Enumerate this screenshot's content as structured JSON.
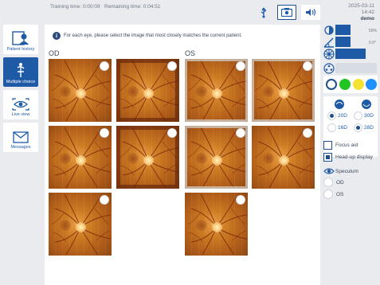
{
  "header": {
    "training_time": "Training time: 0:00:09",
    "remaining_time": "Remaining time: 0:04:51",
    "date": "2025-03-11",
    "time": "14:42",
    "user": "demo"
  },
  "nav": [
    {
      "label": "Patient history",
      "icon": "patient-history-icon"
    },
    {
      "label": "Multiple choice",
      "icon": "multiple-choice-icon",
      "active": true
    },
    {
      "label": "Live view",
      "icon": "live-view-icon"
    },
    {
      "label": "Messages",
      "icon": "messages-icon"
    }
  ],
  "main": {
    "instruction": "For each eye, please select the image that most closely matches the current patient.",
    "od_label": "OD",
    "os_label": "OS"
  },
  "right_panel": {
    "slider1_value": "50%",
    "slider2_value": "0.0°",
    "filter_colors": [
      "#ffffff",
      "#22c422",
      "#f4e233",
      "#1e90ff"
    ],
    "lens_options": {
      "20d": "20D",
      "30d": "30D",
      "16d": "16D",
      "28d": "28D"
    },
    "focus_aid": "Focus aid",
    "head_up_display": "Head-up display",
    "speculum": "Speculum",
    "speculum_od": "OD",
    "speculum_os": "OS"
  }
}
